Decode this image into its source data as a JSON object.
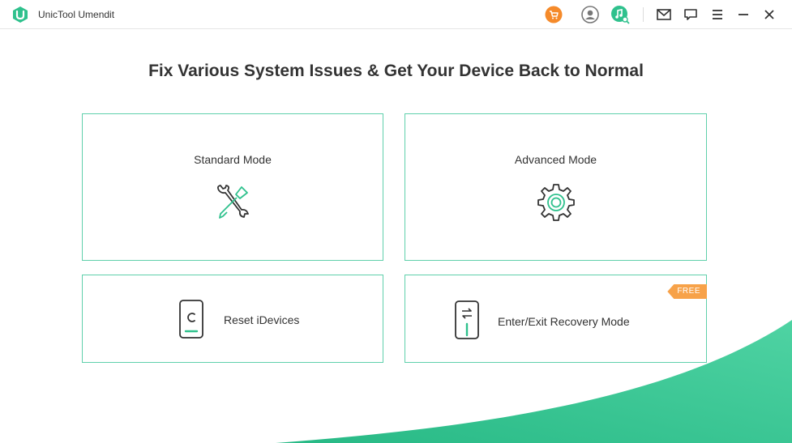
{
  "app": {
    "title": "UnicTool Umendit",
    "logo_icon": "unictool-logo-icon"
  },
  "toolbar": {
    "icons": [
      "cart-icon",
      "user-account-icon",
      "music-search-icon",
      "mail-icon",
      "feedback-icon",
      "menu-icon",
      "minimize-icon",
      "close-icon"
    ]
  },
  "main": {
    "headline": "Fix Various System Issues & Get Your Device Back to Normal"
  },
  "modes": {
    "standard": {
      "label": "Standard Mode",
      "icon": "wrench-screwdriver-icon"
    },
    "advanced": {
      "label": "Advanced Mode",
      "icon": "gear-icon"
    },
    "reset": {
      "label": "Reset iDevices",
      "icon": "phone-reset-icon"
    },
    "recovery": {
      "label": "Enter/Exit Recovery Mode",
      "icon": "phone-recovery-icon",
      "badge": "FREE"
    }
  },
  "colors": {
    "accent": "#2fc18d",
    "card_border": "#5fd0ab",
    "badge": "#f7a249",
    "cart": "#f58a2a"
  }
}
